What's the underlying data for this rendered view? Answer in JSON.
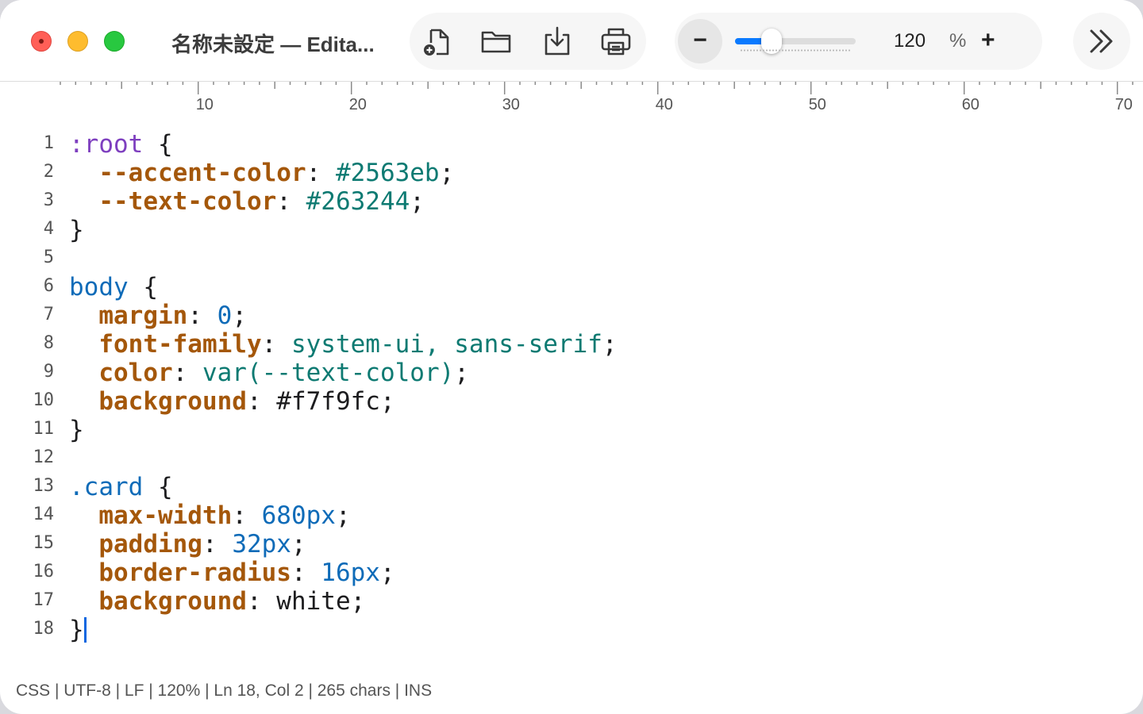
{
  "window": {
    "title": "名称未設定 — Edita..."
  },
  "toolbar": {
    "file_icons": [
      "new-document-icon",
      "open-folder-icon",
      "download-icon",
      "print-icon"
    ],
    "zoom": {
      "minus_label": "−",
      "value": "120",
      "unit": "%",
      "plus_label": "+",
      "slider_level_percent": 30
    },
    "more_icon": "chevrons-right-icon"
  },
  "ruler": {
    "labels": [
      "10",
      "20",
      "30",
      "40",
      "50",
      "60",
      "70"
    ]
  },
  "editor": {
    "lines": [
      {
        "n": "1",
        "tokens": [
          {
            "t": ":root",
            "c": "sel"
          },
          {
            "t": " {",
            "c": "plain"
          }
        ]
      },
      {
        "n": "2",
        "tokens": [
          {
            "t": "  ",
            "c": "plain"
          },
          {
            "t": "--accent-color",
            "c": "prop"
          },
          {
            "t": ": ",
            "c": "plain"
          },
          {
            "t": "#2563eb",
            "c": "str"
          },
          {
            "t": ";",
            "c": "plain"
          }
        ]
      },
      {
        "n": "3",
        "tokens": [
          {
            "t": "  ",
            "c": "plain"
          },
          {
            "t": "--text-color",
            "c": "prop"
          },
          {
            "t": ": ",
            "c": "plain"
          },
          {
            "t": "#263244",
            "c": "str"
          },
          {
            "t": ";",
            "c": "plain"
          }
        ]
      },
      {
        "n": "4",
        "tokens": [
          {
            "t": "}",
            "c": "plain"
          }
        ]
      },
      {
        "n": "5",
        "tokens": []
      },
      {
        "n": "6",
        "tokens": [
          {
            "t": "body",
            "c": "body"
          },
          {
            "t": " {",
            "c": "plain"
          }
        ]
      },
      {
        "n": "7",
        "tokens": [
          {
            "t": "  ",
            "c": "plain"
          },
          {
            "t": "margin",
            "c": "prop"
          },
          {
            "t": ": ",
            "c": "plain"
          },
          {
            "t": "0",
            "c": "val"
          },
          {
            "t": ";",
            "c": "plain"
          }
        ]
      },
      {
        "n": "8",
        "tokens": [
          {
            "t": "  ",
            "c": "plain"
          },
          {
            "t": "font-family",
            "c": "prop"
          },
          {
            "t": ": ",
            "c": "plain"
          },
          {
            "t": "system-ui, sans-serif",
            "c": "str"
          },
          {
            "t": ";",
            "c": "plain"
          }
        ]
      },
      {
        "n": "9",
        "tokens": [
          {
            "t": "  ",
            "c": "plain"
          },
          {
            "t": "color",
            "c": "prop"
          },
          {
            "t": ": ",
            "c": "plain"
          },
          {
            "t": "var(--text-color)",
            "c": "str"
          },
          {
            "t": ";",
            "c": "plain"
          }
        ]
      },
      {
        "n": "10",
        "tokens": [
          {
            "t": "  ",
            "c": "plain"
          },
          {
            "t": "background",
            "c": "prop"
          },
          {
            "t": ": #f7f9fc;",
            "c": "plain"
          }
        ]
      },
      {
        "n": "11",
        "tokens": [
          {
            "t": "}",
            "c": "plain"
          }
        ]
      },
      {
        "n": "12",
        "tokens": []
      },
      {
        "n": "13",
        "tokens": [
          {
            "t": ".card",
            "c": "body"
          },
          {
            "t": " {",
            "c": "plain"
          }
        ]
      },
      {
        "n": "14",
        "tokens": [
          {
            "t": "  ",
            "c": "plain"
          },
          {
            "t": "max-width",
            "c": "prop"
          },
          {
            "t": ": ",
            "c": "plain"
          },
          {
            "t": "680px",
            "c": "val"
          },
          {
            "t": ";",
            "c": "plain"
          }
        ]
      },
      {
        "n": "15",
        "tokens": [
          {
            "t": "  ",
            "c": "plain"
          },
          {
            "t": "padding",
            "c": "prop"
          },
          {
            "t": ": ",
            "c": "plain"
          },
          {
            "t": "32px",
            "c": "val"
          },
          {
            "t": ";",
            "c": "plain"
          }
        ]
      },
      {
        "n": "16",
        "tokens": [
          {
            "t": "  ",
            "c": "plain"
          },
          {
            "t": "border-radius",
            "c": "prop"
          },
          {
            "t": ": ",
            "c": "plain"
          },
          {
            "t": "16px",
            "c": "val"
          },
          {
            "t": ";",
            "c": "plain"
          }
        ]
      },
      {
        "n": "17",
        "tokens": [
          {
            "t": "  ",
            "c": "plain"
          },
          {
            "t": "background",
            "c": "prop"
          },
          {
            "t": ": white;",
            "c": "plain"
          }
        ]
      },
      {
        "n": "18",
        "tokens": [
          {
            "t": "}",
            "c": "plain"
          }
        ],
        "caret": true
      }
    ]
  },
  "status": {
    "text": "CSS | UTF-8 | LF | 120% | Ln 18, Col 2 | 265 chars | INS"
  },
  "colors": {
    "accent": "#0a7aff",
    "selector": "#7e3fbf",
    "property": "#a4570a",
    "value": "#0e6bb8",
    "string": "#0d7a72"
  }
}
